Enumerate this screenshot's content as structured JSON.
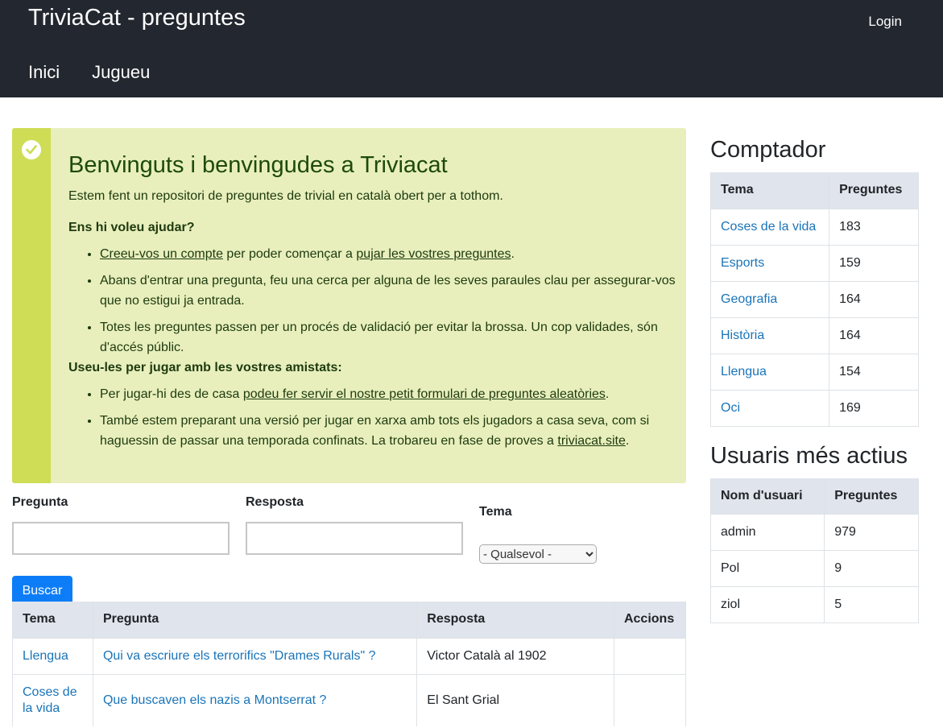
{
  "header": {
    "site_title": "TriviaCat - preguntes",
    "login": "Login",
    "nav": [
      "Inici",
      "Jugueu"
    ]
  },
  "welcome": {
    "title": "Benvinguts i benvingudes a Triviacat",
    "lead": "Estem fent un repositori de preguntes de trivial en català obert per a tothom.",
    "help_heading": "Ens hi voleu ajudar?",
    "help_item1_link1": "Creeu-vos un compte",
    "help_item1_mid": " per poder començar a ",
    "help_item1_link2": "pujar les vostres preguntes",
    "help_item1_end": ".",
    "help_item2": "Abans d'entrar una pregunta, feu una cerca per alguna de les seves paraules clau per assegurar-vos que no estigui ja entrada.",
    "help_item3": "Totes les preguntes passen per un procés de validació per evitar la brossa. Un cop validades, són d'accés públic.",
    "play_heading": "Useu-les per jugar amb les vostres amistats:",
    "play_item1_start": "Per jugar-hi des de casa ",
    "play_item1_link": "podeu fer servir el nostre petit formulari de preguntes aleatòries",
    "play_item1_end": ".",
    "play_item2_start": "També estem preparant una versió per jugar en xarxa amb tots els jugadors a casa seva, com si haguessin de passar una temporada confinats. La trobareu en fase de proves a ",
    "play_item2_link": "triviacat.site",
    "play_item2_end": "."
  },
  "search": {
    "pregunta_label": "Pregunta",
    "resposta_label": "Resposta",
    "tema_label": "Tema",
    "tema_selected": "- Qualsevol -",
    "pregunta_value": "",
    "resposta_value": "",
    "button": "Buscar"
  },
  "questions": {
    "headers": [
      "Tema",
      "Pregunta",
      "Resposta",
      "Accions"
    ],
    "rows": [
      {
        "tema": "Llengua",
        "pregunta": "Qui va escriure els terrorifics \"Drames Rurals\" ?",
        "resposta": "Victor Català al 1902",
        "accions": ""
      },
      {
        "tema": "Coses de la vida",
        "pregunta": "Que buscaven els nazis a Montserrat ?",
        "resposta": "El Sant Grial",
        "accions": ""
      }
    ]
  },
  "counter": {
    "title": "Comptador",
    "headers": [
      "Tema",
      "Preguntes"
    ],
    "rows": [
      {
        "tema": "Coses de la vida",
        "count": "183"
      },
      {
        "tema": "Esports",
        "count": "159"
      },
      {
        "tema": "Geografia",
        "count": "164"
      },
      {
        "tema": "Història",
        "count": "164"
      },
      {
        "tema": "Llengua",
        "count": "154"
      },
      {
        "tema": "Oci",
        "count": "169"
      }
    ]
  },
  "active_users": {
    "title": "Usuaris més actius",
    "headers": [
      "Nom d'usuari",
      "Preguntes"
    ],
    "rows": [
      {
        "user": "admin",
        "count": "979"
      },
      {
        "user": "Pol",
        "count": "9"
      },
      {
        "user": "ziol",
        "count": "5"
      }
    ]
  },
  "colors": {
    "header_bg": "#23272f",
    "alert_bg": "#e8efbd",
    "alert_bar": "#cedd55",
    "link": "#1a74b8",
    "button": "#0d7df7"
  }
}
